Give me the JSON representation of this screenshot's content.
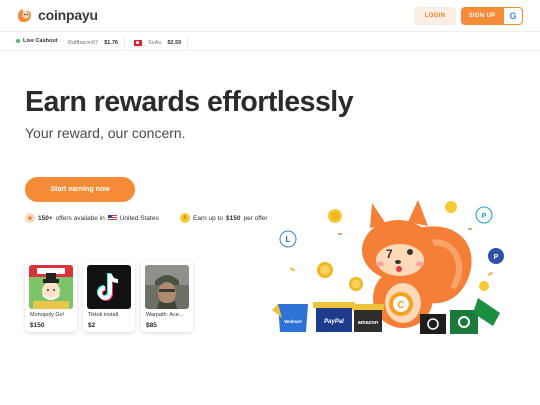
{
  "header": {
    "logo_text": "coinpayu",
    "login_label": "LOGIN",
    "signup_label": "SIGN UP",
    "google_label": "G"
  },
  "ticker": {
    "live_label": "Live Cashout",
    "items": [
      {
        "user": "Raffbaron97",
        "amount": "$1.76"
      },
      {
        "user": "SuAu",
        "amount": "$2.59"
      }
    ]
  },
  "hero": {
    "title": "Earn rewards effortlessly",
    "subtitle": "Your reward, our concern.",
    "cta_label": "Start earning now"
  },
  "stats": {
    "offers_count": "150+",
    "offers_text": "offers availabe in",
    "country": "United States",
    "earn_prefix": "Earn up to",
    "earn_amount": "$150",
    "earn_suffix": "per offer"
  },
  "offers": [
    {
      "name": "Monopoly Go!",
      "amount": "$150"
    },
    {
      "name": "Tiktok install",
      "amount": "$2"
    },
    {
      "name": "Warpath: Ace...",
      "amount": "$85"
    }
  ],
  "gift_labels": {
    "walmart": "Walmart",
    "paypal": "PayPal",
    "amazon": "amazon"
  },
  "colors": {
    "accent": "#f58b36",
    "accent_light": "#fdeee3",
    "text": "#2b2b2b"
  }
}
